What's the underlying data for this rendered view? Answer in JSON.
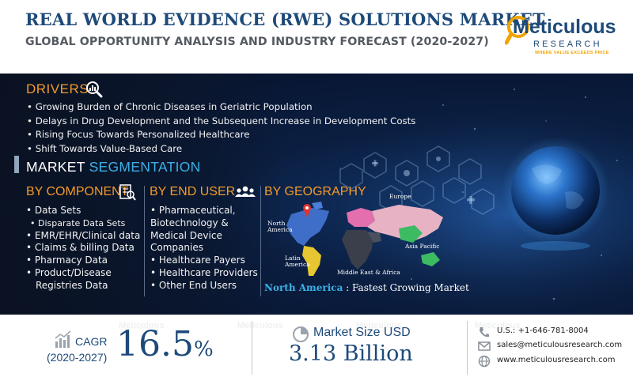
{
  "header": {
    "title": "REAL WORLD EVIDENCE (RWE) SOLUTIONS MARKET",
    "subtitle": "GLOBAL OPPORTUNITY ANALYSIS AND INDUSTRY FORECAST (2020-2027)"
  },
  "logo": {
    "name_main": "Meticulous",
    "name_sub": "RESEARCH",
    "tagline": "WHERE VALUE EXCEEDS PRICE"
  },
  "drivers": {
    "heading": "DRIVERS",
    "items": [
      "• Growing Burden of Chronic Diseases in Geriatric Population",
      "• Delays in Drug Development and the Subsequent Increase in Development Costs",
      "• Rising Focus Towards Personalized Healthcare",
      "• Shift Towards Value-Based Care"
    ]
  },
  "segmentation": {
    "heading_part1": "MARKET ",
    "heading_part2": "SEGMENTATION",
    "by_component": {
      "heading": "BY COMPONENT",
      "items": [
        "• Data Sets",
        "• Disparate Data Sets",
        "• EMR/EHR/Clinical data",
        "• Claims & billing Data",
        "• Pharmacy Data",
        "• Product/Disease",
        "   Registries Data"
      ]
    },
    "by_end_user": {
      "heading": "BY END USER",
      "items": [
        "•  Pharmaceutical,",
        "Biotechnology &",
        "Medical Device",
        "Companies",
        "• Healthcare Payers",
        "• Healthcare Providers",
        "• Other End Users"
      ]
    },
    "by_geography": {
      "heading": "BY GEOGRAPHY",
      "regions": {
        "north_america": [
          "North",
          "America"
        ],
        "europe": "Europe",
        "latin_america": [
          "Latin",
          "America"
        ],
        "asia_pacific": "Asia Pacific",
        "mea": "Middle East & Africa"
      },
      "highlight_region": "North America",
      "highlight_text": ": Fastest Growing Market"
    }
  },
  "footer": {
    "cagr_label": "CAGR",
    "cagr_years": "(2020-2027)",
    "cagr_value": "16.5",
    "cagr_unit": "%",
    "market_size_label": "Market Size USD",
    "market_size_value": "3.13 Billion",
    "contact": {
      "phone": "U.S.: +1-646-781-8004",
      "email": "sales@meticulousresearch.com",
      "website": "www.meticulousresearch.com"
    }
  },
  "watermark": "Meticulous",
  "colors": {
    "navy": "#1e4a79",
    "orange": "#f49a2a",
    "blue_accent": "#3cb0e6",
    "gold": "#f0a400"
  }
}
